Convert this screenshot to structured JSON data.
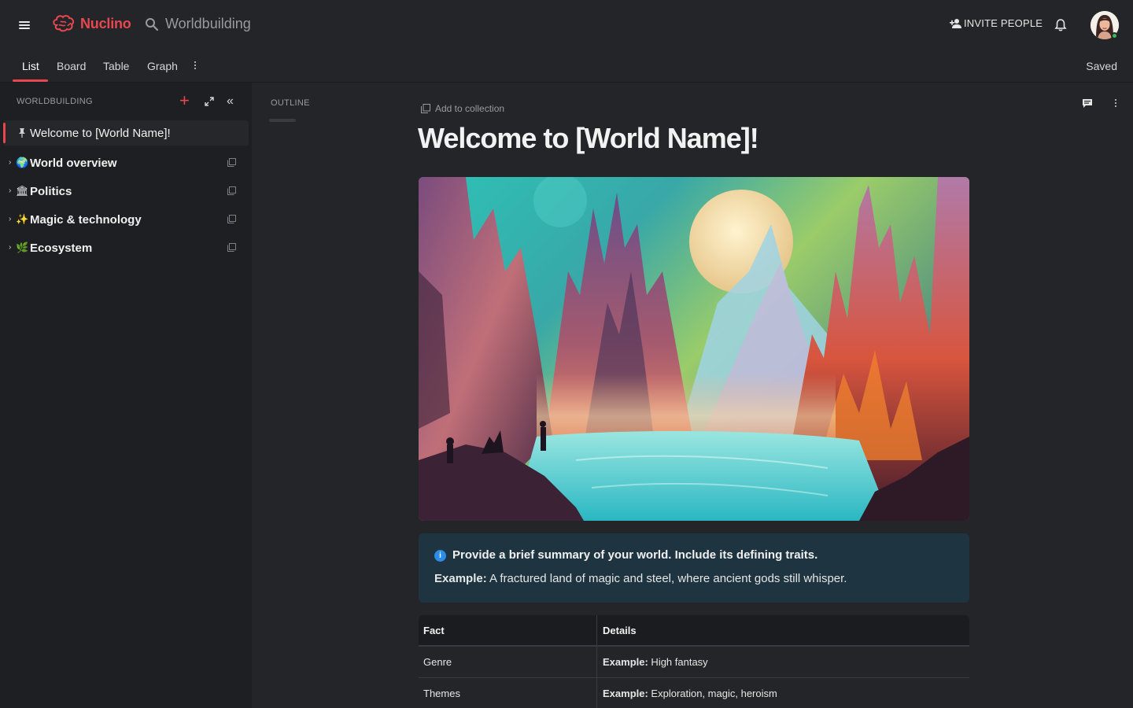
{
  "app": {
    "brand": "Nuclino",
    "workspace": "Worldbuilding",
    "invite_label": "INVITE PEOPLE",
    "accent_color": "#e8474f"
  },
  "views": {
    "tabs": [
      {
        "label": "List",
        "active": true
      },
      {
        "label": "Board"
      },
      {
        "label": "Table"
      },
      {
        "label": "Graph"
      }
    ],
    "status": "Saved"
  },
  "sidebar": {
    "title": "WORLDBUILDING",
    "items": [
      {
        "icon": "pin-icon",
        "emoji": "",
        "label": "Welcome to [World Name]!",
        "active": true
      },
      {
        "icon": "globe-icon",
        "emoji": "🌍",
        "label": "World overview"
      },
      {
        "icon": "classical-building-icon",
        "emoji": "🏛",
        "label": "Politics"
      },
      {
        "icon": "sparkles-icon",
        "emoji": "✨",
        "label": "Magic & technology"
      },
      {
        "icon": "herb-icon",
        "emoji": "🌿",
        "label": "Ecosystem"
      }
    ]
  },
  "outline": {
    "title": "OUTLINE"
  },
  "document": {
    "add_to_collection": "Add to collection",
    "title": "Welcome to [World Name]!",
    "callout": {
      "heading": "Provide a brief summary of your world. Include its defining traits.",
      "example_prefix": "Example:",
      "example_text": " A fractured land of magic and steel, where ancient gods still whisper."
    },
    "facts_table": {
      "headers": [
        "Fact",
        "Details"
      ],
      "rows": [
        {
          "fact": "Genre",
          "prefix": "Example:",
          "details": " High fantasy"
        },
        {
          "fact": "Themes",
          "prefix": "Example:",
          "details": " Exploration, magic, heroism"
        }
      ]
    }
  }
}
